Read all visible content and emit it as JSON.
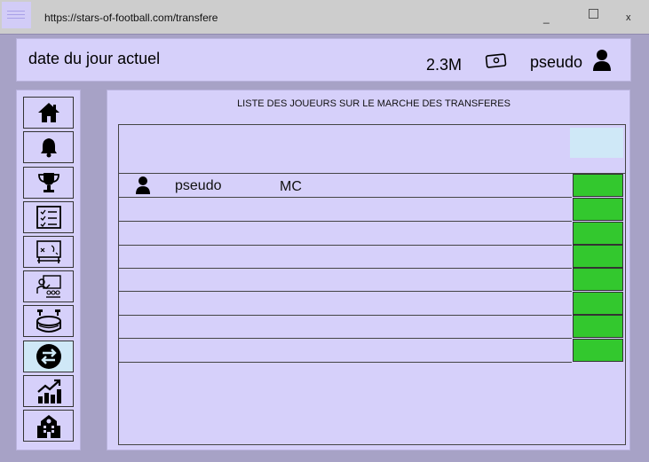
{
  "browser": {
    "url": "https://stars-of-football.com/transfere",
    "minimize": "_",
    "close": "x"
  },
  "header": {
    "date": "date du jour actuel",
    "money": "2.3M",
    "username": "pseudo"
  },
  "sidebar": {
    "items": [
      {
        "icon": "home-icon"
      },
      {
        "icon": "bell-icon"
      },
      {
        "icon": "trophy-icon"
      },
      {
        "icon": "checklist-icon"
      },
      {
        "icon": "tactics-board-icon"
      },
      {
        "icon": "training-icon"
      },
      {
        "icon": "stadium-icon"
      },
      {
        "icon": "transfer-icon",
        "active": true
      },
      {
        "icon": "growth-chart-icon"
      },
      {
        "icon": "club-building-icon"
      }
    ]
  },
  "main": {
    "title": "LISTE DES JOUEURS SUR LE MARCHE DES TRANSFERES",
    "rows": [
      {
        "pseudo": "pseudo",
        "position": "MC"
      },
      {
        "pseudo": "",
        "position": ""
      },
      {
        "pseudo": "",
        "position": ""
      },
      {
        "pseudo": "",
        "position": ""
      },
      {
        "pseudo": "",
        "position": ""
      },
      {
        "pseudo": "",
        "position": ""
      },
      {
        "pseudo": "",
        "position": ""
      },
      {
        "pseudo": "",
        "position": ""
      }
    ]
  },
  "colors": {
    "panel": "#d6d0fa",
    "background": "#a7a2c6",
    "action_green": "#33c82e",
    "active_blue": "#cfe8f7"
  }
}
